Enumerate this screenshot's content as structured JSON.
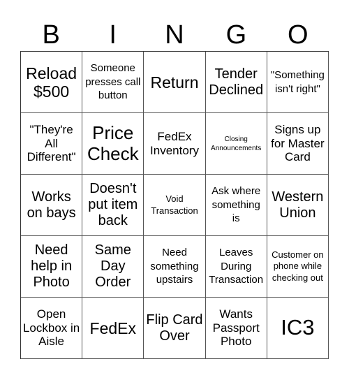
{
  "header": [
    "B",
    "I",
    "N",
    "G",
    "O"
  ],
  "cells": [
    "Reload $500",
    "Someone presses call button",
    "Return",
    "Tender Declined",
    "\"Something isn't right\"",
    "\"They're All Different\"",
    "Price Check",
    "FedEx Inventory",
    "Closing Announcements",
    "Signs up for Master Card",
    "Works on bays",
    "Doesn't put item back",
    "Void Transaction",
    "Ask where something is",
    "Western Union",
    "Need help in Photo",
    "Same Day Order",
    "Need something upstairs",
    "Leaves During Transaction",
    "Customer on phone while checking out",
    "Open Lockbox in Aisle",
    "FedEx",
    "Flip Card Over",
    "Wants Passport Photo",
    "IC3"
  ]
}
